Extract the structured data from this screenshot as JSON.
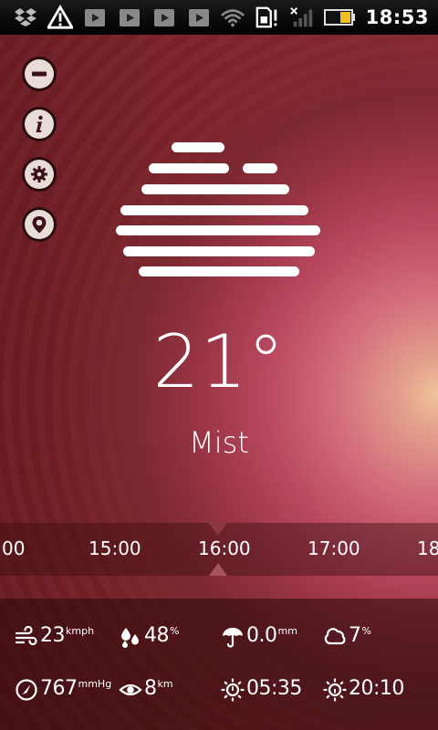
{
  "status_bar": {
    "time": "18:53",
    "icons": [
      "dropbox-icon",
      "warning-icon",
      "play-icon",
      "play-icon",
      "play-icon",
      "play-icon",
      "wifi-icon",
      "sim-icon",
      "signal-icon",
      "battery-icon"
    ]
  },
  "side_buttons": [
    "minus-icon",
    "info-icon",
    "gear-icon",
    "location-pin-icon"
  ],
  "weather": {
    "icon": "mist-icon",
    "temperature": "21°",
    "condition": "Mist"
  },
  "timeline": {
    "labels": [
      "00",
      "15:00",
      "16:00",
      "17:00",
      "18"
    ],
    "selected": "16:00"
  },
  "stats": {
    "wind": {
      "value": "23",
      "unit": "kmph",
      "icon": "wind-icon"
    },
    "humidity": {
      "value": "48",
      "unit": "%",
      "icon": "humidity-drops-icon"
    },
    "precipitation": {
      "value": "0.0",
      "unit": "mm",
      "icon": "umbrella-icon"
    },
    "cloudiness": {
      "value": "7",
      "unit": "%",
      "icon": "cloud-icon"
    },
    "pressure": {
      "value": "767",
      "unit": "mmHg",
      "icon": "pressure-gauge-icon"
    },
    "visibility": {
      "value": "8",
      "unit": "km",
      "icon": "eye-icon"
    },
    "sunrise": {
      "value": "05:35",
      "unit": "",
      "icon": "sunrise-icon"
    },
    "sunset": {
      "value": "20:10",
      "unit": "",
      "icon": "sunset-icon"
    }
  },
  "colors": {
    "background": "#7a2329",
    "glow": "#f0c49a",
    "statusbar": "#000000",
    "battery": "#f0c020"
  }
}
